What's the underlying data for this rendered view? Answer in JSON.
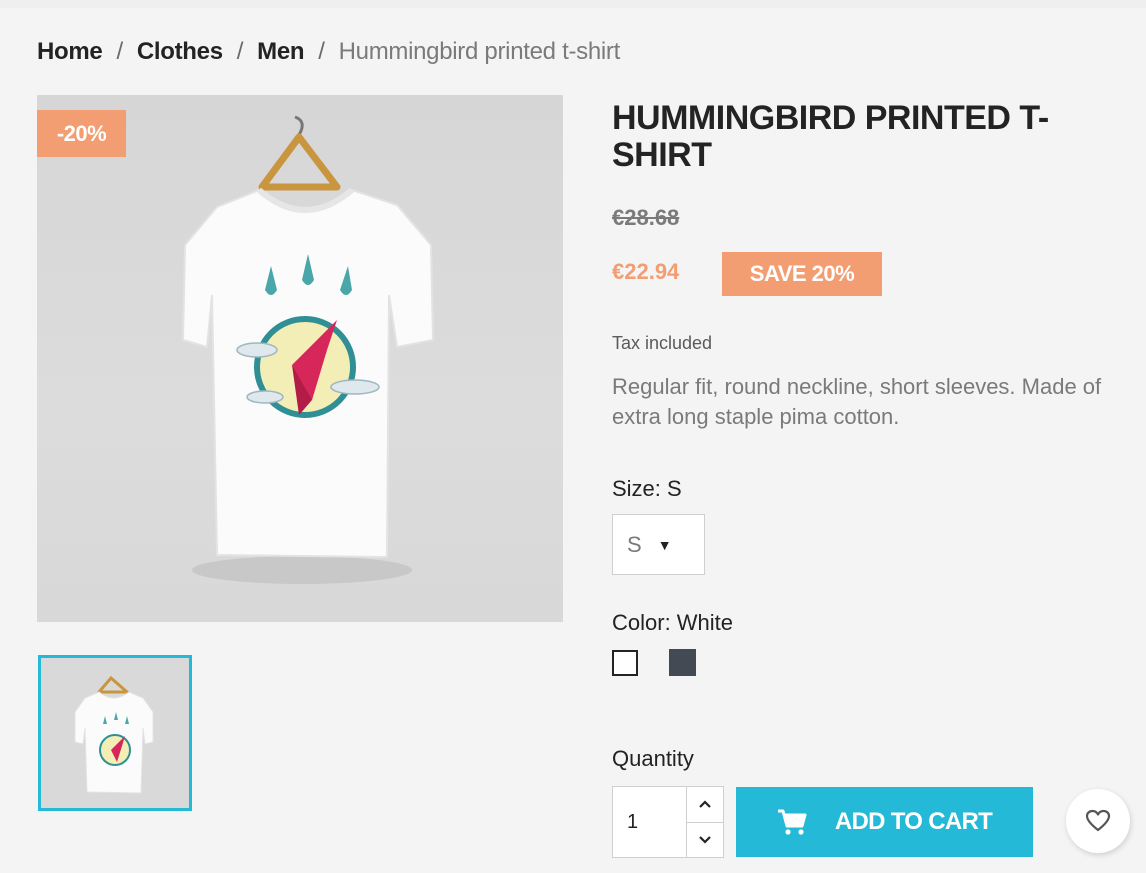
{
  "breadcrumb": {
    "items": [
      "Home",
      "Clothes",
      "Men"
    ],
    "current": "Hummingbird printed t-shirt",
    "separator": "/"
  },
  "product": {
    "title": "HUMMINGBIRD PRINTED T-SHIRT",
    "discount_flag": "-20%",
    "regular_price": "€28.68",
    "current_price": "€22.94",
    "save_badge": "SAVE 20%",
    "tax_label": "Tax included",
    "description": "Regular fit, round neckline, short sleeves. Made of extra long staple pima cotton."
  },
  "options": {
    "size_label": "Size: S",
    "size_selected": "S",
    "color_label": "Color: White",
    "colors": [
      {
        "name": "White",
        "hex": "#ffffff",
        "selected": true
      },
      {
        "name": "Black",
        "hex": "#434a54",
        "selected": false
      }
    ]
  },
  "cart": {
    "quantity_label": "Quantity",
    "quantity_value": "1",
    "add_to_cart_label": "ADD TO CART"
  },
  "colors": {
    "accent": "#24b9d7",
    "discount": "#f39d72",
    "text": "#232323",
    "muted": "#7a7a7a"
  },
  "icons": {
    "cart": "shopping-cart-icon",
    "wishlist": "heart-icon",
    "caret": "caret-down-icon",
    "qty_up": "chevron-up-icon",
    "qty_down": "chevron-down-icon"
  }
}
